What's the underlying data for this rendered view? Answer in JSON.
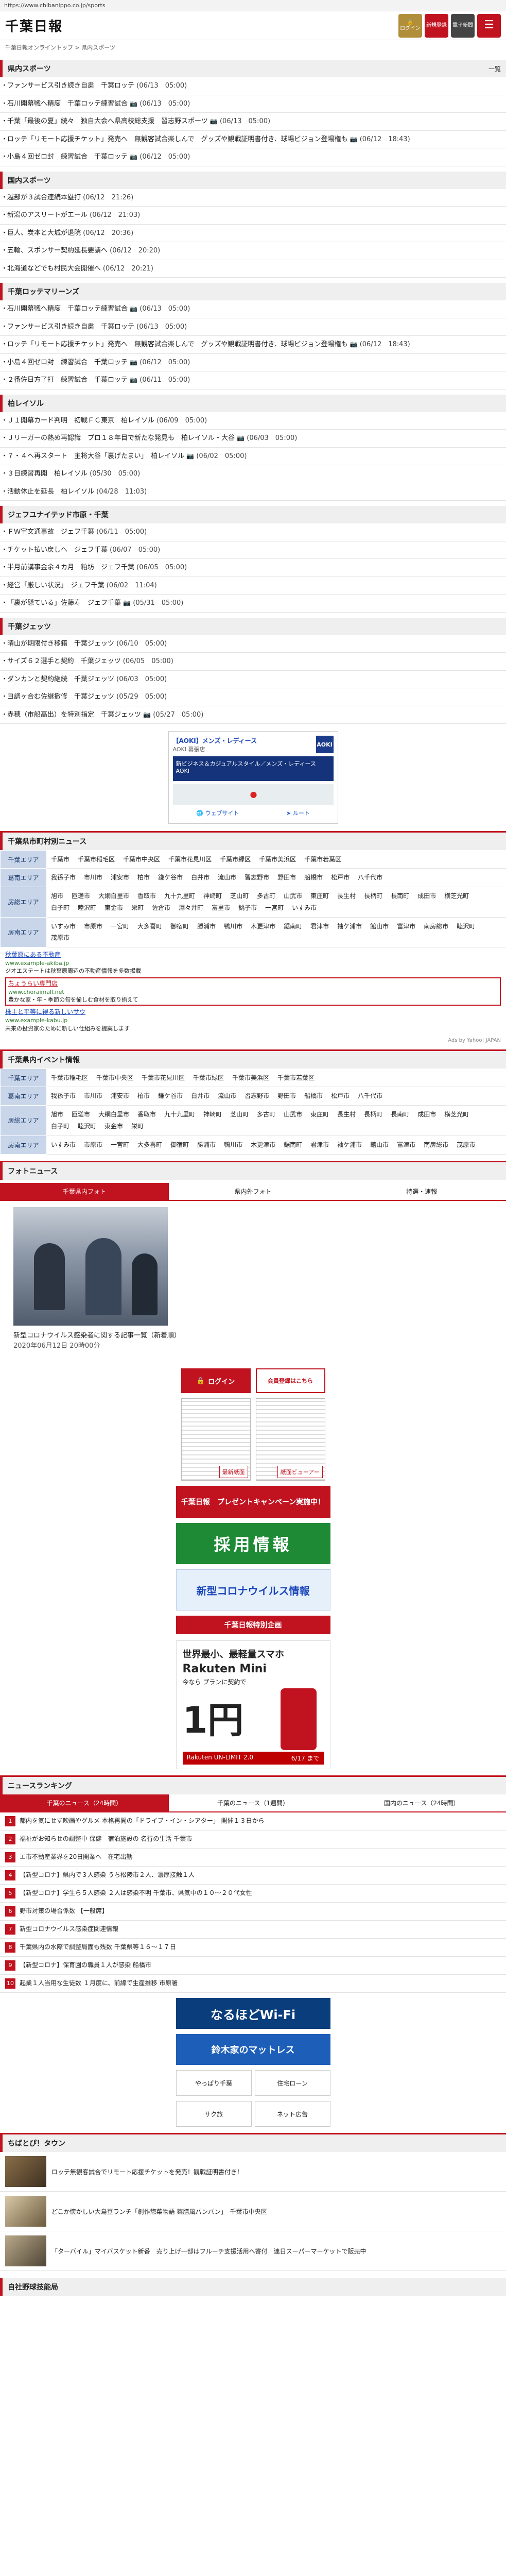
{
  "url": "https://www.chibanippo.co.jp/sports",
  "header": {
    "logo": "千葉日報",
    "login_label": "ログイン",
    "register_label": "新規登録",
    "paper_label": "電子新聞",
    "menu_icon": "hamburger-icon"
  },
  "breadcrumb": "千葉日報オンライントップ > 県内スポーツ",
  "sections": {
    "pref_sports": {
      "title": "県内スポーツ",
      "more": "一覧",
      "items": [
        {
          "text": "ファンサービス引き続き自粛　千葉ロッテ",
          "date": "(06/13　05:00)"
        },
        {
          "text": "石川開幕戦へ精度　千葉ロッテ練習試合",
          "date": "(06/13　05:00)",
          "photo": true
        },
        {
          "text": "千葉「最後の夏」続々　独自大会へ県高校総支援　習志野スポーツ",
          "date": "(06/13　05:00)",
          "photo": true
        },
        {
          "text": "ロッテ「リモート応援チケット」発売へ　無観客試合楽しんで　グッズや観戦証明書付き、球場ビジョン登場権も",
          "date": "(06/12　18:43)",
          "photo": true
        },
        {
          "text": "小島４回ゼロ封　練習試合　千葉ロッテ",
          "date": "(06/12　05:00)",
          "photo": true
        }
      ]
    },
    "domestic_sports": {
      "title": "国内スポーツ",
      "items": [
        {
          "text": "越部が３試合連続本塁打",
          "date": "(06/12　21:26)"
        },
        {
          "text": "新潟のアスリートがエール",
          "date": "(06/12　21:03)"
        },
        {
          "text": "巨人、炭本と大城が退院",
          "date": "(06/12　20:36)"
        },
        {
          "text": "五輪、スポンサー契約延長要請へ",
          "date": "(06/12　20:20)"
        },
        {
          "text": "北海道などでも村民大会開催へ",
          "date": "(06/12　20:21)"
        }
      ]
    },
    "marines": {
      "title": "千葉ロッテマリーンズ",
      "items": [
        {
          "text": "石川開幕戦へ精度　千葉ロッテ練習試合",
          "date": "(06/13　05:00)",
          "photo": true
        },
        {
          "text": "ファンサービス引き続き自粛　千葉ロッテ",
          "date": "(06/13　05:00)"
        },
        {
          "text": "ロッテ「リモート応援チケット」発売へ　無観客試合楽しんで　グッズや観戦証明書付き、球場ビジョン登場権も",
          "date": "(06/12　18:43)",
          "photo": true
        },
        {
          "text": "小島４回ゼロ封　練習試合　千葉ロッテ",
          "date": "(06/12　05:00)",
          "photo": true
        },
        {
          "text": "２番佐日方了打　練習試合　千葉ロッテ",
          "date": "(06/11　05:00)",
          "photo": true
        }
      ]
    },
    "reysol": {
      "title": "柏レイソル",
      "items": [
        {
          "text": "Ｊ１開幕カード判明　初戦ＦＣ東京　柏レイソル",
          "date": "(06/09　05:00)"
        },
        {
          "text": "Ｊリーガーの熱め再認識　プロ１８年目で新たな発見も　柏レイソル・大谷",
          "date": "(06/03　05:00)",
          "photo": true
        },
        {
          "text": "７・４へ再スタート　主将大谷「裏げたまい」　柏レイソル",
          "date": "(06/02　05:00)",
          "photo": true
        },
        {
          "text": "３日練習再開　柏レイソル",
          "date": "(05/30　05:00)"
        },
        {
          "text": "活動休止を延長　柏レイソル",
          "date": "(04/28　11:03)"
        }
      ]
    },
    "jef": {
      "title": "ジェフユナイテッド市原・千葉",
      "items": [
        {
          "text": "ＦＷ宇文通事故　ジェフ千葉",
          "date": "(06/11　05:00)"
        },
        {
          "text": "チケット払い戻しへ　ジェフ千葉",
          "date": "(06/07　05:00)"
        },
        {
          "text": "半月前講事金余４カ月　粕坊　ジェフ千葉",
          "date": "(06/05　05:00)"
        },
        {
          "text": "経営「厳しい状況」　ジェフ千葉",
          "date": "(06/02　11:04)"
        },
        {
          "text": "「裏が懸ている」佐藤寿　ジェフ千葉",
          "date": "(05/31　05:00)",
          "photo": true
        }
      ]
    },
    "jets": {
      "title": "千葉ジェッツ",
      "items": [
        {
          "text": "晴山が期限付き移籍　千葉ジェッツ",
          "date": "(06/10　05:00)"
        },
        {
          "text": "サイズ６２選手と契約　千葉ジェッツ",
          "date": "(06/05　05:00)"
        },
        {
          "text": "ダンカンと契約継続　千葉ジェッツ",
          "date": "(06/03　05:00)"
        },
        {
          "text": "ヨ調ヶ合む佐継撤修　千葉ジェッツ",
          "date": "(05/29　05:00)"
        },
        {
          "text": "赤穂（市船高出）を特別指定　千葉ジェッツ",
          "date": "(05/27　05:00)",
          "photo": true
        }
      ]
    }
  },
  "ad": {
    "title": "【AOKI】メンズ・レディース",
    "sub": "AOKI 幕張店",
    "logo": "AOKI",
    "banner": "新ビジネス＆カジュアルスタイル／メンズ・レディース AOKI",
    "website": "ウェブサイト",
    "route": "ルート"
  },
  "city_news": {
    "title": "千葉県市町村別ニュース",
    "rows": [
      {
        "area": "千葉エリア",
        "cities": [
          "千葉市",
          "千葉市稲毛区",
          "千葉市中央区",
          "千葉市花見川区",
          "千葉市緑区",
          "千葉市美浜区",
          "千葉市若葉区"
        ]
      },
      {
        "area": "葛南エリア",
        "cities": [
          "我孫子市",
          "市川市",
          "浦安市",
          "柏市",
          "鎌ケ谷市",
          "白井市",
          "流山市",
          "習志野市",
          "野田市",
          "船橋市",
          "松戸市",
          "八千代市"
        ]
      },
      {
        "area": "房総エリア",
        "cities": [
          "旭市",
          "匝瑳市",
          "大網白里市",
          "香取市",
          "九十九里町",
          "神崎町",
          "芝山町",
          "多古町",
          "山武市",
          "東庄町",
          "長生村",
          "長柄町",
          "長南町",
          "成田市",
          "横芝光町",
          "白子町",
          "睦沢町",
          "東金市",
          "栄町",
          "佐倉市",
          "酒々井町",
          "富里市",
          "銚子市",
          "一宮町",
          "いすみ市"
        ]
      },
      {
        "area": "房南エリア",
        "cities": [
          "いすみ市",
          "市原市",
          "一宮町",
          "大多喜町",
          "御宿町",
          "勝浦市",
          "鴨川市",
          "木更津市",
          "鋸南町",
          "君津市",
          "袖ケ浦市",
          "館山市",
          "富津市",
          "南房総市",
          "睦沢町",
          "茂原市"
        ]
      }
    ]
  },
  "text_ads": [
    {
      "title": "秋葉原にある不動産",
      "url": "www.example-akiba.jp",
      "desc": "ジオエステートは秋葉原周辺の不動産情報を多数掲載"
    },
    {
      "title": "ちょうらい専門店",
      "url": "www.choraimall.net",
      "desc": "豊かな家・年・季節の旬を愉しむ食材を取り揃えて",
      "highlight": true
    },
    {
      "title": "株主と平等に得る新しいサウ",
      "url": "www.example-kabu.jp",
      "desc": "未来の投資家のために新しい仕組みを提案します"
    }
  ],
  "ads_by": "Ads by Yahoo! JAPAN",
  "event_info": {
    "title": "千葉県内イベント情報",
    "rows": [
      {
        "area": "千葉エリア",
        "cities": [
          "千葉市稲毛区",
          "千葉市中央区",
          "千葉市花見川区",
          "千葉市緑区",
          "千葉市美浜区",
          "千葉市若葉区"
        ]
      },
      {
        "area": "葛南エリア",
        "cities": [
          "我孫子市",
          "市川市",
          "浦安市",
          "柏市",
          "鎌ケ谷市",
          "白井市",
          "流山市",
          "習志野市",
          "野田市",
          "船橋市",
          "松戸市",
          "八千代市"
        ]
      },
      {
        "area": "房総エリア",
        "cities": [
          "旭市",
          "匝瑳市",
          "大網白里市",
          "香取市",
          "九十九里町",
          "神崎町",
          "芝山町",
          "多古町",
          "山武市",
          "東庄町",
          "長生村",
          "長柄町",
          "長南町",
          "成田市",
          "横芝光町",
          "白子町",
          "睦沢町",
          "東金市",
          "栄町"
        ]
      },
      {
        "area": "房南エリア",
        "cities": [
          "いすみ市",
          "市原市",
          "一宮町",
          "大多喜町",
          "御宿町",
          "勝浦市",
          "鴨川市",
          "木更津市",
          "鋸南町",
          "君津市",
          "袖ケ浦市",
          "館山市",
          "富津市",
          "南房総市",
          "茂原市"
        ]
      }
    ]
  },
  "photo_news": {
    "title": "フォトニュース",
    "tabs": [
      "千葉県内フォト",
      "県内外フォト",
      "特選・速報"
    ],
    "caption": "新型コロナウイルス感染者に関する記事一覧（新着順）",
    "date": "2020年06月12日 20時00分"
  },
  "widgets": {
    "login": "ログイン",
    "register": "会員登録はこちら",
    "paper1": "最新紙面",
    "paper2": "紙面ビューアー",
    "present": "千葉日報　プレゼントキャンペーン実施中！",
    "job": "採用情報",
    "corona": "新型コロナウイルス情報",
    "special": "千葉日報特別企画"
  },
  "rakuten_ad": {
    "h1": "世界最小、最軽量スマホ",
    "h2": "Rakuten Mini",
    "h3": "今なら プランに契約で",
    "price": "1円",
    "foot_left": "Rakuten UN-LIMIT 2.0",
    "foot_right": "6/17 まで"
  },
  "ranking": {
    "title": "ニュースランキング",
    "tabs": [
      "千葉のニュース（24時間）",
      "千葉のニュース（1週間）",
      "国内のニュース（24時間）"
    ],
    "items": [
      "都内を気にせず映画やグルメ 本格再開の「ドライブ・イン・シアター」 開催１３日から",
      "福祉がお知らせの調整中 保健　宿泊施設の 名行の生活 千葉市",
      "エ市不動産業界を20日開業へ　在宅出勤",
      "【新型コロナ】県内で３人感染 うち松陵市２人、濃厚接触１人",
      "【新型コロナ】学生ら５人感染 ２人は感染不明 千葉市、県気中の１０～２０代女性",
      "野市対策の場合係数 【一般席】",
      "新型コロナウイルス感染症関連情報",
      "千葉県内の水際で調整局面も残数 千葉県等１６～１７日",
      "【新型コロナ】保育園の職員１人が感染 船橋市",
      "起業１人当用な生徒数 １月度に、前線で生産推移 市原署"
    ]
  },
  "bottom_banners": {
    "wifi": "なるほどWi-Fi",
    "mat": "鈴木家のマットレス",
    "b1": "やっぱり千葉",
    "b2": "住宅ローン",
    "b3": "サク旅",
    "b4": "ネット広告"
  },
  "town": {
    "title": "ちばとぴ！タウン",
    "items": [
      "ロッテ無観客試合でリモート応援チケットを発売！観戦証明書付き！",
      "どこか懐かしい大島豆ランチ「創作惣菜物語 薬膳風パンパン」　千葉市中央区",
      "「ターバイル」マイバスケット新番　売り上げ一部はフルーチ支援活用へ寄付　連日スーパーマーケットで販売中"
    ]
  },
  "footer_title": "自社野球技能局"
}
